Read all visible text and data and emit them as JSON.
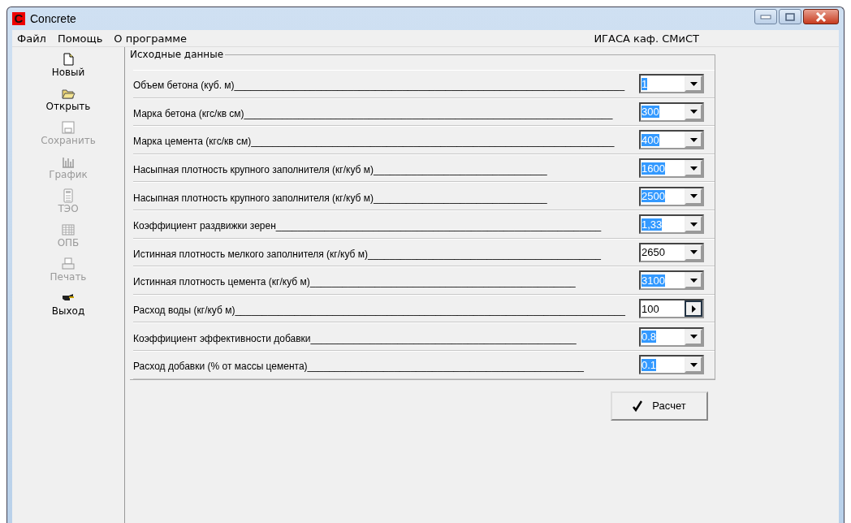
{
  "window": {
    "title": "Concrete",
    "app_icon": "C"
  },
  "menu": {
    "items": [
      "Файл",
      "Помощь",
      "О программе"
    ],
    "right_text": "ИГАСА каф. СМиСТ"
  },
  "sidebar": {
    "items": [
      {
        "kind": "new",
        "label": "Новый",
        "disabled": false
      },
      {
        "kind": "open",
        "label": "Открыть",
        "disabled": false
      },
      {
        "kind": "save",
        "label": "Сохранить",
        "disabled": true
      },
      {
        "kind": "chart",
        "label": "График",
        "disabled": true
      },
      {
        "kind": "calc",
        "label": "ТЭО",
        "disabled": true
      },
      {
        "kind": "table",
        "label": "ОПБ",
        "disabled": true
      },
      {
        "kind": "print",
        "label": "Печать",
        "disabled": true
      },
      {
        "kind": "exit",
        "label": "Выход",
        "disabled": false
      }
    ]
  },
  "group": {
    "title": "Исходные данные",
    "rows": [
      {
        "label": "Объем бетона (куб. м)________________________________________________________________________",
        "value": "1",
        "selected": true,
        "kind": "dropdown"
      },
      {
        "label": "Марка бетона (кгс/кв см)____________________________________________________________________",
        "value": "300",
        "selected": true,
        "kind": "dropdown"
      },
      {
        "label": "Марка цемента (кгс/кв см)___________________________________________________________________",
        "value": "400",
        "selected": true,
        "kind": "dropdown"
      },
      {
        "label": "Насыпная плотность крупного заполнителя (кг/куб м)________________________________",
        "value": "1600",
        "selected": true,
        "kind": "dropdown"
      },
      {
        "label": "Насыпная плотность крупного заполнителя (кг/куб м)________________________________",
        "value": "2500",
        "selected": true,
        "kind": "dropdown"
      },
      {
        "label": "Коэффициент раздвижки зерен____________________________________________________________",
        "value": "1,33",
        "selected": true,
        "kind": "dropdown"
      },
      {
        "label": "Истинная плотность мелкого заполнителя (кг/куб м)___________________________________________",
        "value": "2650",
        "selected": false,
        "kind": "dropdown"
      },
      {
        "label": "Истинная плотность цемента (кг/куб м)_________________________________________________",
        "value": "3100",
        "selected": true,
        "kind": "dropdown"
      },
      {
        "label": "Расход воды (кг/куб м)________________________________________________________________________",
        "value": "100",
        "selected": false,
        "kind": "spin"
      },
      {
        "label": "Коэффициент эффективности добавки_________________________________________________",
        "value": "0.8",
        "selected": true,
        "kind": "dropdown"
      },
      {
        "label": "Расход добавки (% от массы цемента)___________________________________________________",
        "value": "0.1",
        "selected": true,
        "kind": "dropdown"
      }
    ]
  },
  "calc_button": {
    "label": "Расчет"
  }
}
